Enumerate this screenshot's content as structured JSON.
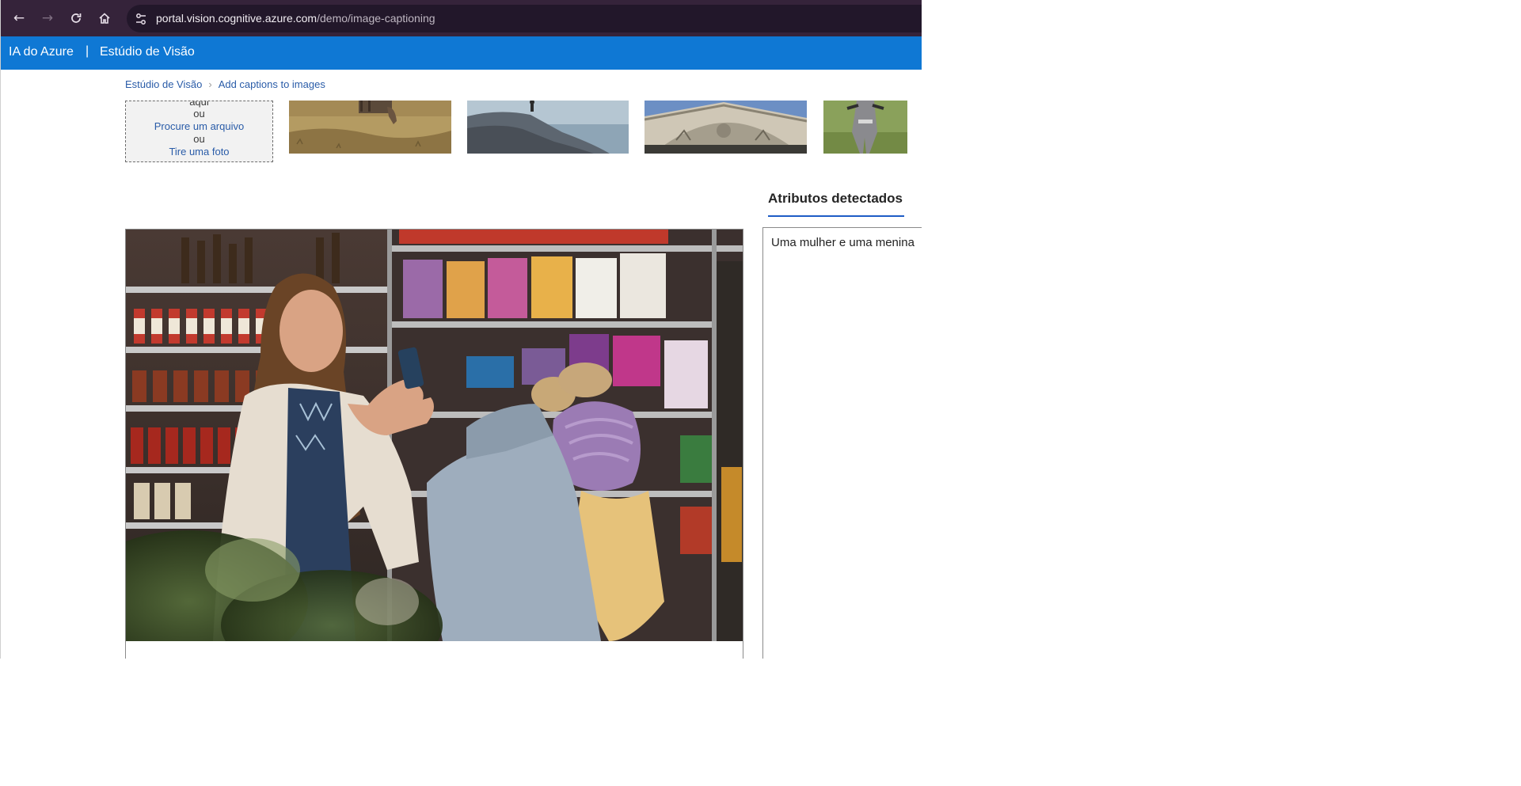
{
  "browser": {
    "url_host": "portal.vision.cognitive.azure.com",
    "url_path": "/demo/image-captioning"
  },
  "header": {
    "brand": "IA do Azure",
    "separator": "|",
    "product": "Estúdio de Visão"
  },
  "breadcrumb": {
    "root": "Estúdio de Visão",
    "current": "Add captions to images"
  },
  "upload": {
    "drop_text": "aqui",
    "or_1": "ou",
    "browse_link": "Procure um arquivo",
    "or_2": "ou",
    "photo_link": "Tire uma foto"
  },
  "results": {
    "tab_label": "Atributos detectados",
    "caption": "Uma mulher e uma menina"
  },
  "colors": {
    "azure_blue": "#0f78d4",
    "browser_chrome": "#35233a",
    "link": "#2a5ca8"
  }
}
